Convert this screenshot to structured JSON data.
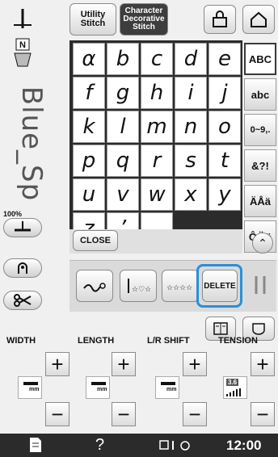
{
  "header": {
    "utility_label": "Utility\nStitch",
    "character_label": "Character\nDecorative\nStitch"
  },
  "display": {
    "text": "Blue_Sp",
    "zoom": "100%"
  },
  "keyboard": {
    "rows": [
      [
        "α",
        "b",
        "c",
        "d",
        "e"
      ],
      [
        "f",
        "g",
        "h",
        "i",
        "j"
      ],
      [
        "k",
        "l",
        "m",
        "n",
        "o"
      ],
      [
        "p",
        "q",
        "r",
        "s",
        "t"
      ],
      [
        "u",
        "v",
        "w",
        "x",
        "y"
      ],
      [
        "z",
        "’",
        "space"
      ]
    ],
    "side_labels": [
      "ABC",
      "abc",
      "0~9,.",
      "&?!",
      "ÄÅä",
      "ÔÖö"
    ],
    "close_label": "CLOSE"
  },
  "edit": {
    "delete_label": "DELETE"
  },
  "params": {
    "width_label": "WIDTH",
    "length_label": "LENGTH",
    "shift_label": "L/R SHIFT",
    "tension_label": "TENSION",
    "mm": "mm",
    "tension_value": "3.6"
  },
  "footer": {
    "time": "12:00",
    "help": "?"
  },
  "colors": {
    "highlight": "#2a8fd8",
    "footer_bg": "#2b2b2b"
  }
}
